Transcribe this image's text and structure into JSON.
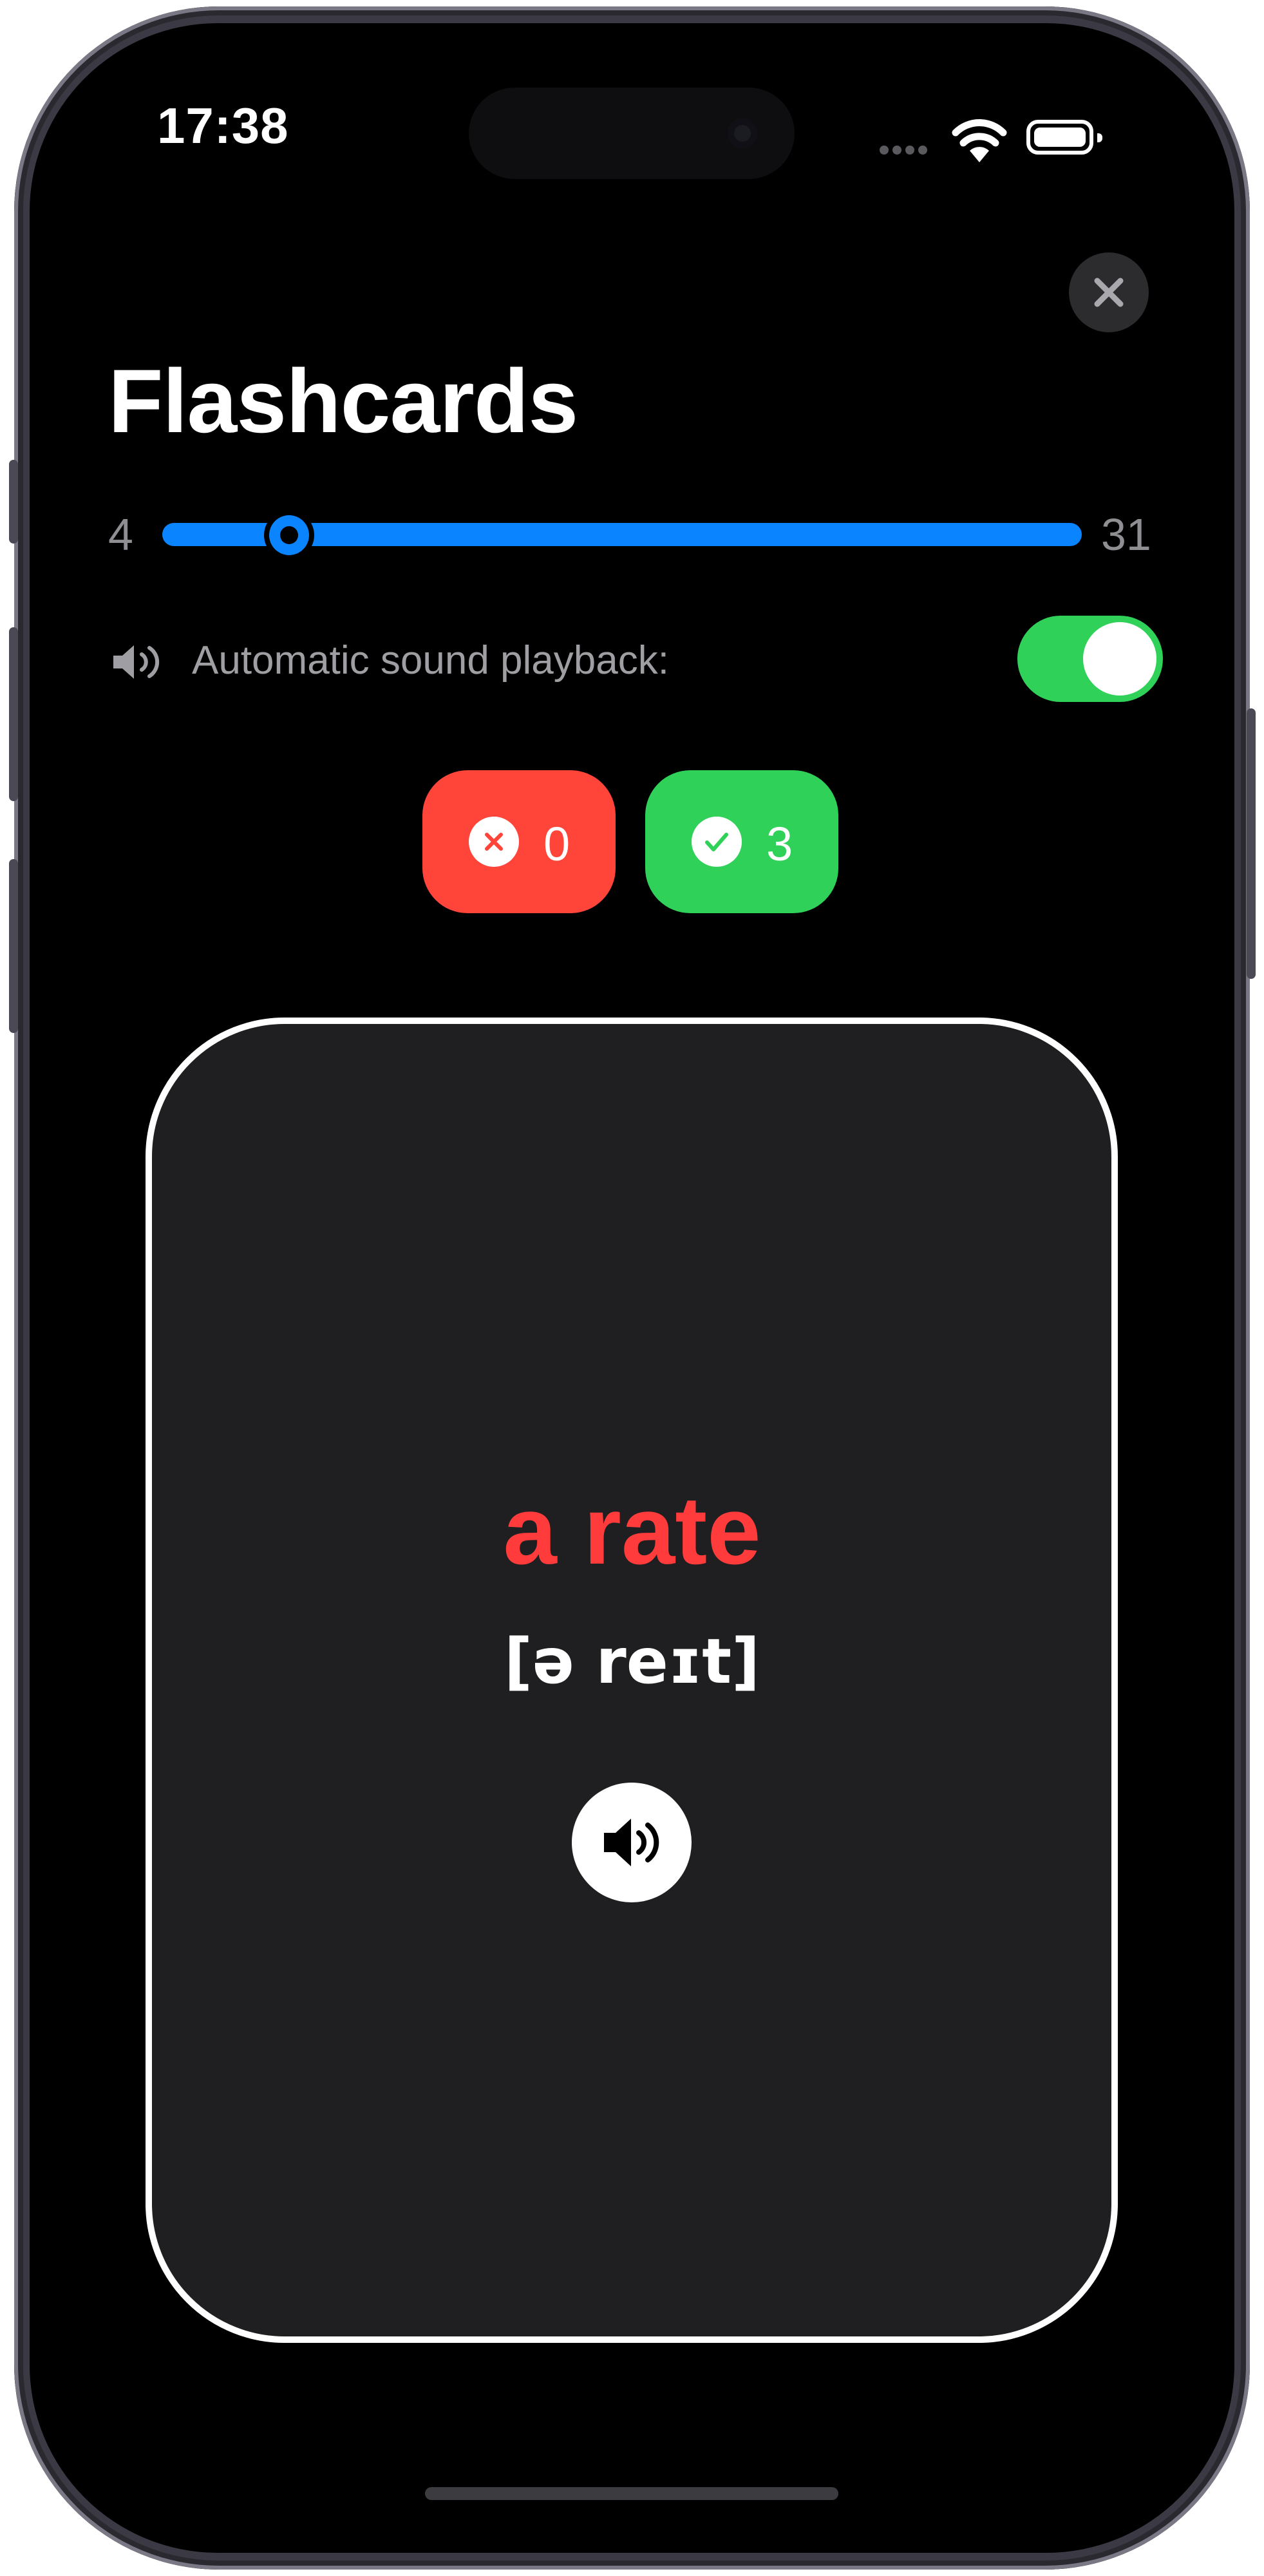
{
  "status_bar": {
    "time": "17:38",
    "icons": [
      "cellular-signal-icon",
      "wifi-icon",
      "battery-icon"
    ]
  },
  "header": {
    "title": "Flashcards",
    "close_icon": "close-icon"
  },
  "range_slider": {
    "min_label": "4",
    "max_label": "31",
    "position_fraction": 0.08,
    "accent_color": "#0a84ff"
  },
  "sound_setting": {
    "icon": "speaker-icon",
    "label": "Automatic sound playback:",
    "enabled": true,
    "toggle_color": "#30d158"
  },
  "score": {
    "wrong": {
      "icon": "x-circle-icon",
      "count": "0",
      "color": "#ff453a"
    },
    "correct": {
      "icon": "check-circle-icon",
      "count": "3",
      "color": "#30d158"
    }
  },
  "card": {
    "word": "a rate",
    "word_color": "#ff3b3b",
    "transcription": "[ə reɪt]",
    "play_icon": "speaker-icon"
  }
}
